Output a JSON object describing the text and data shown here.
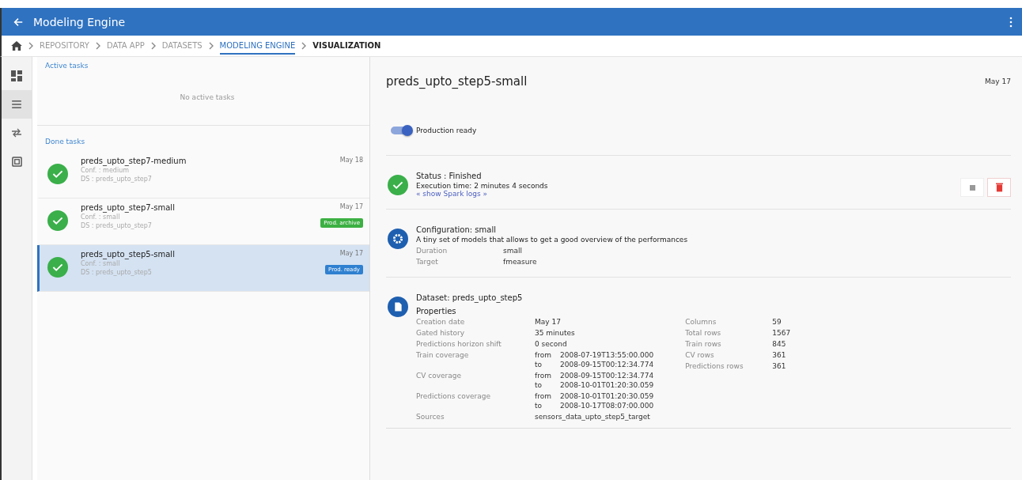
{
  "window": {
    "title": "Modeling Engine"
  },
  "breadcrumb": [
    {
      "label": "REPOSITORY",
      "selected": false
    },
    {
      "label": "DATA APP",
      "selected": false
    },
    {
      "label": "DATASETS",
      "selected": false
    },
    {
      "label": "MODELING ENGINE",
      "selected": true
    },
    {
      "label": "VISUALIZATION",
      "selected": false
    }
  ],
  "sidebar": {
    "items": [
      {
        "kind": "dashboard",
        "selected": false
      },
      {
        "kind": "list",
        "selected": true
      },
      {
        "kind": "compare",
        "selected": false
      },
      {
        "kind": "box",
        "selected": false
      }
    ]
  },
  "active_tasks": {
    "title": "Active tasks",
    "empty_text": "No active tasks"
  },
  "done_tasks": {
    "title": "Done tasks",
    "items": [
      {
        "name": "preds_upto_step7-medium",
        "conf": "Conf. : medium",
        "ds": "DS : preds_upto_step7",
        "date": "May 18",
        "selected": false
      },
      {
        "name": "preds_upto_step7-small",
        "conf": "Conf. : small",
        "ds": "DS : preds_upto_step7",
        "date": "May 17",
        "badge": {
          "label": "Prod. archive",
          "color": "#3cb043"
        },
        "selected": false
      },
      {
        "name": "preds_upto_step5-small",
        "conf": "Conf. : small",
        "ds": "DS : preds_upto_step5",
        "date": "May 17",
        "badge": {
          "label": "Prod. ready",
          "color": "#2f80d0"
        },
        "selected": true
      }
    ]
  },
  "detail": {
    "title": "preds_upto_step5-small",
    "date": "May 17",
    "production": {
      "label": "Production ready",
      "on": true
    },
    "status": {
      "title": "Status : Finished",
      "time": "Execution time: 2 minutes 4 seconds",
      "link": "« show Spark logs »"
    },
    "configuration": {
      "title": "Configuration: small",
      "description": "A tiny set of models that allows to get a good overview of the performances",
      "fields": [
        {
          "label": "Duration",
          "value": "small"
        },
        {
          "label": "Target",
          "value": "fmeasure"
        }
      ]
    },
    "dataset": {
      "title": "Dataset: preds_upto_step5",
      "properties_title": "Properties",
      "left": [
        {
          "label": "Creation date",
          "lines": [
            {
              "value": "May 17"
            }
          ]
        },
        {
          "label": "Gated history",
          "lines": [
            {
              "value": "35 minutes"
            }
          ]
        },
        {
          "label": "Predictions horizon shift",
          "lines": [
            {
              "value": "0 second"
            }
          ]
        },
        {
          "label": "Train coverage",
          "lines": [
            {
              "prefix": "from",
              "value": "2008-07-19T13:55:00.000"
            },
            {
              "prefix": "to",
              "value": "2008-09-15T00:12:34.774"
            }
          ]
        },
        {
          "label": "CV coverage",
          "lines": [
            {
              "prefix": "from",
              "value": "2008-09-15T00:12:34.774"
            },
            {
              "prefix": "to",
              "value": "2008-10-01T01:20:30.059"
            }
          ]
        },
        {
          "label": "Predictions coverage",
          "lines": [
            {
              "prefix": "from",
              "value": "2008-10-01T01:20:30.059"
            },
            {
              "prefix": "to",
              "value": "2008-10-17T08:07:00.000"
            }
          ]
        },
        {
          "label": "Sources",
          "lines": [
            {
              "value": "sensors_data_upto_step5_target"
            }
          ]
        }
      ],
      "right": [
        {
          "label": "Columns",
          "value": "59"
        },
        {
          "label": "Total rows",
          "value": "1567"
        },
        {
          "label": "Train rows",
          "value": "845"
        },
        {
          "label": "CV rows",
          "value": "361"
        },
        {
          "label": "Predictions rows",
          "value": "361"
        }
      ]
    }
  }
}
